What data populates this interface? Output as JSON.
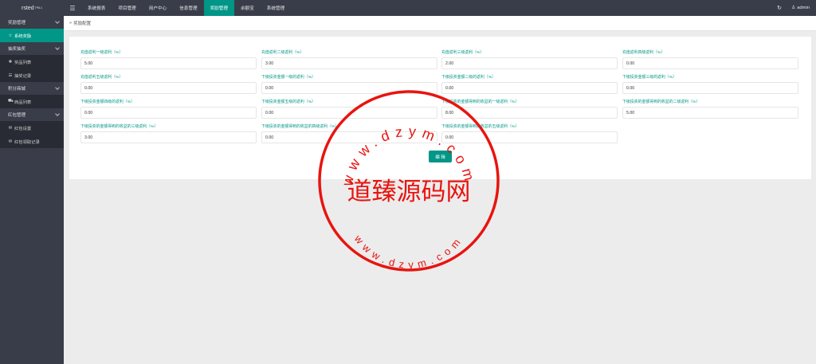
{
  "app": {
    "title": "rsted",
    "version": "TP6.1"
  },
  "topnav": {
    "menu_icon": "menu-icon",
    "items": [
      {
        "label": "系统报表",
        "active": false
      },
      {
        "label": "项目管理",
        "active": false
      },
      {
        "label": "用户中心",
        "active": false
      },
      {
        "label": "信息管理",
        "active": false
      },
      {
        "label": "奖励管理",
        "active": true
      },
      {
        "label": "余额宝",
        "active": false
      },
      {
        "label": "系统管理",
        "active": false
      }
    ],
    "refresh_icon": "refresh-icon",
    "user": {
      "icon": "user-icon",
      "name": "admin"
    }
  },
  "sidebar": {
    "groups": [
      {
        "label": "奖励管理",
        "items": [
          {
            "icon": "star-icon",
            "label": "系统奖励",
            "active": true
          }
        ]
      },
      {
        "label": "抽奖抽奖",
        "items": [
          {
            "icon": "plus-icon",
            "label": "奖品列表"
          },
          {
            "icon": "list-icon",
            "label": "抽奖记录"
          }
        ]
      },
      {
        "label": "积分商城",
        "items": [
          {
            "icon": "cart-icon",
            "label": "商品列表"
          }
        ]
      },
      {
        "label": "红包管理",
        "items": [
          {
            "icon": "mail-icon",
            "label": "红包设置"
          },
          {
            "icon": "mail-icon",
            "label": "红包领取记录"
          }
        ]
      }
    ]
  },
  "breadcrumb": {
    "icon": "breadcrumb-arrow-icon",
    "text": "奖励配置"
  },
  "form": {
    "fields": [
      {
        "label": "充值返利一级返利（%）",
        "value": "5.00"
      },
      {
        "label": "充值返利二级返利（%）",
        "value": "3.00"
      },
      {
        "label": "充值返利三级返利（%）",
        "value": "2.00"
      },
      {
        "label": "充值返利四级返利（%）",
        "value": "0.00"
      },
      {
        "label": "充值返利五级返利（%）",
        "value": "0.00"
      },
      {
        "label": "下级投资金额一级的返利（%）",
        "value": "0.00"
      },
      {
        "label": "下级投资金额二级的返利（%）",
        "value": "0.00"
      },
      {
        "label": "下级投资金额三级的返利（%）",
        "value": "0.00"
      },
      {
        "label": "下级投资金额四级的返利（%）",
        "value": "0.00"
      },
      {
        "label": "下级投资金额五级的返利（%）",
        "value": "0.00"
      },
      {
        "label": "下级投资的金额得到的收益的一级返利（%）",
        "value": "8.00"
      },
      {
        "label": "下级投资的金额得到的收益的二级返利（%）",
        "value": "5.00"
      },
      {
        "label": "下级投资的金额得到的收益的三级返利（%）",
        "value": "3.00"
      },
      {
        "label": "下级投资的金额得到的收益的四级返利（%）",
        "value": "0.00"
      },
      {
        "label": "下级投资的金额得到的收益的五级返利（%）",
        "value": "0.00"
      }
    ],
    "submit_label": "编 辑"
  },
  "watermark": {
    "top_text": "www.dzym.com",
    "center_text": "道臻源码网",
    "bottom_text": "www.dzym.com",
    "color": "#e8140f"
  },
  "colors": {
    "accent": "#009688",
    "topbar": "#393d49",
    "sidebar_sub": "#282b33"
  }
}
